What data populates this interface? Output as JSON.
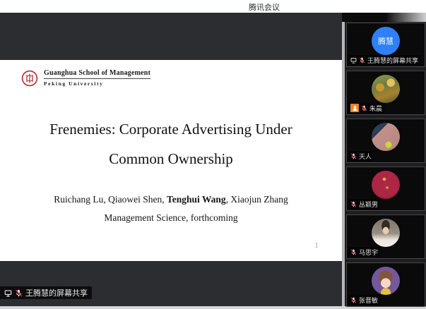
{
  "app": {
    "title_bar": "腾讯会议"
  },
  "slide": {
    "logo": {
      "institution": "Guanghua School of Management",
      "university": "Peking University"
    },
    "title_line1": "Frenemies: Corporate Advertising Under",
    "title_line2": "Common Ownership",
    "authors": {
      "prefix": "Ruichang Lu, Qiaowei Shen, ",
      "highlight": "Tenghui Wang",
      "suffix": ", Xiaojun Zhang"
    },
    "venue": "Management Science, forthcoming",
    "page_number": "1"
  },
  "share_banner": {
    "label": "王腾慧的屏幕共享"
  },
  "sidebar": {
    "participants": [
      {
        "name": "王腾慧的屏幕共享",
        "avatar_text": "腾慧",
        "muted": true,
        "screen_sharing": true
      },
      {
        "name": "朱晨",
        "muted": true,
        "has_host_badge": true
      },
      {
        "name": "天人",
        "muted": true
      },
      {
        "name": "丛颖男",
        "muted": true
      },
      {
        "name": "马思宇",
        "muted": true
      },
      {
        "name": "张晋敏",
        "muted": true
      }
    ]
  },
  "colors": {
    "accent_blue": "#2F80F7",
    "mute_red": "#E23B3B",
    "host_badge_orange": "#F28322",
    "seal_red": "#B53636",
    "app_background": "#2B2D30",
    "slide_background": "#FFFFFF"
  }
}
